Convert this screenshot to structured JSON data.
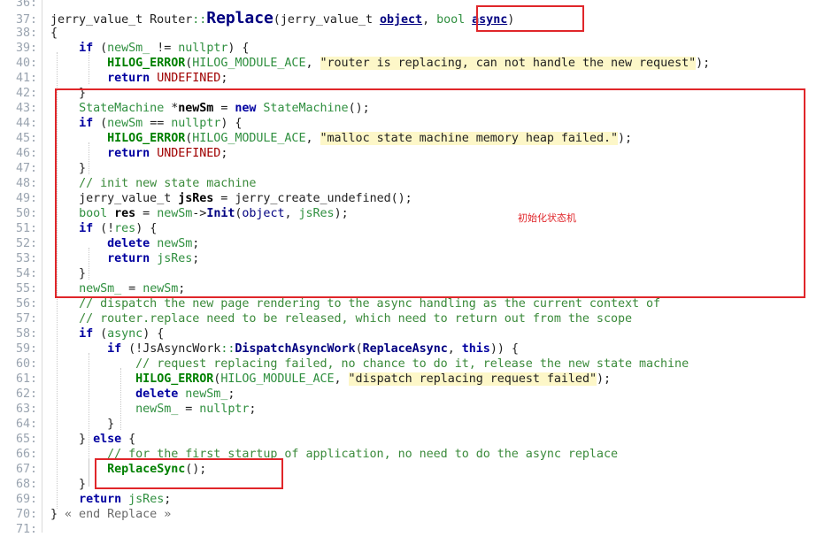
{
  "lines": [
    {
      "n": "36:",
      "tokens": []
    },
    {
      "n": "37:",
      "tokens": [
        {
          "c": "t-type",
          "t": "jerry_value_t "
        },
        {
          "c": "t-type",
          "t": "Router"
        },
        {
          "c": "t-ns",
          "t": "::"
        },
        {
          "c": "t-fnbig",
          "t": "Replace"
        },
        {
          "c": "t-op",
          "t": "("
        },
        {
          "c": "t-type",
          "t": "jerry_value_t "
        },
        {
          "c": "t-param",
          "t": "object"
        },
        {
          "c": "t-op",
          "t": ", "
        },
        {
          "c": "t-green",
          "t": "bool "
        },
        {
          "c": "t-param",
          "t": "async"
        },
        {
          "c": "t-op",
          "t": ")"
        }
      ]
    },
    {
      "n": "38:",
      "tokens": [
        {
          "c": "t-op",
          "t": "{"
        }
      ]
    },
    {
      "n": "39:",
      "tokens": [
        {
          "c": "t-op",
          "t": "    "
        },
        {
          "c": "t-kw",
          "t": "if"
        },
        {
          "c": "t-op",
          "t": " ("
        },
        {
          "c": "t-green",
          "t": "newSm_"
        },
        {
          "c": "t-op",
          "t": " != "
        },
        {
          "c": "t-nul",
          "t": "nullptr"
        },
        {
          "c": "t-op",
          "t": ") {"
        }
      ]
    },
    {
      "n": "40:",
      "tokens": [
        {
          "c": "t-op",
          "t": "        "
        },
        {
          "c": "t-mac",
          "t": "HILOG_ERROR"
        },
        {
          "c": "t-op",
          "t": "("
        },
        {
          "c": "t-macarg",
          "t": "HILOG_MODULE_ACE"
        },
        {
          "c": "t-op",
          "t": ", "
        },
        {
          "c": "t-str",
          "t": "\"router is replacing, can not handle the new request\""
        },
        {
          "c": "t-op",
          "t": ");"
        }
      ]
    },
    {
      "n": "41:",
      "tokens": [
        {
          "c": "t-op",
          "t": "        "
        },
        {
          "c": "t-kw",
          "t": "return"
        },
        {
          "c": "t-op",
          "t": " "
        },
        {
          "c": "t-const",
          "t": "UNDEFINED"
        },
        {
          "c": "t-op",
          "t": ";"
        }
      ]
    },
    {
      "n": "42:",
      "tokens": [
        {
          "c": "t-op",
          "t": "    }"
        }
      ]
    },
    {
      "n": "43:",
      "tokens": [
        {
          "c": "t-op",
          "t": "    "
        },
        {
          "c": "t-cls",
          "t": "StateMachine"
        },
        {
          "c": "t-op",
          "t": " *"
        },
        {
          "c": "t-varb",
          "t": "newSm"
        },
        {
          "c": "t-op",
          "t": " = "
        },
        {
          "c": "t-kw",
          "t": "new"
        },
        {
          "c": "t-op",
          "t": " "
        },
        {
          "c": "t-cls",
          "t": "StateMachine"
        },
        {
          "c": "t-op",
          "t": "();"
        }
      ]
    },
    {
      "n": "44:",
      "tokens": [
        {
          "c": "t-op",
          "t": "    "
        },
        {
          "c": "t-kw",
          "t": "if"
        },
        {
          "c": "t-op",
          "t": " ("
        },
        {
          "c": "t-green",
          "t": "newSm"
        },
        {
          "c": "t-op",
          "t": " == "
        },
        {
          "c": "t-nul",
          "t": "nullptr"
        },
        {
          "c": "t-op",
          "t": ") {"
        }
      ]
    },
    {
      "n": "45:",
      "tokens": [
        {
          "c": "t-op",
          "t": "        "
        },
        {
          "c": "t-mac",
          "t": "HILOG_ERROR"
        },
        {
          "c": "t-op",
          "t": "("
        },
        {
          "c": "t-macarg",
          "t": "HILOG_MODULE_ACE"
        },
        {
          "c": "t-op",
          "t": ", "
        },
        {
          "c": "t-str",
          "t": "\"malloc state machine memory heap failed.\""
        },
        {
          "c": "t-op",
          "t": ");"
        }
      ]
    },
    {
      "n": "46:",
      "tokens": [
        {
          "c": "t-op",
          "t": "        "
        },
        {
          "c": "t-kw",
          "t": "return"
        },
        {
          "c": "t-op",
          "t": " "
        },
        {
          "c": "t-const",
          "t": "UNDEFINED"
        },
        {
          "c": "t-op",
          "t": ";"
        }
      ]
    },
    {
      "n": "47:",
      "tokens": [
        {
          "c": "t-op",
          "t": "    }"
        }
      ]
    },
    {
      "n": "48:",
      "tokens": [
        {
          "c": "t-op",
          "t": "    "
        },
        {
          "c": "t-com",
          "t": "// init new state machine"
        }
      ]
    },
    {
      "n": "49:",
      "tokens": [
        {
          "c": "t-op",
          "t": "    "
        },
        {
          "c": "t-type",
          "t": "jerry_value_t "
        },
        {
          "c": "t-varb",
          "t": "jsRes"
        },
        {
          "c": "t-op",
          "t": " = "
        },
        {
          "c": "t-type",
          "t": "jerry_create_undefined"
        },
        {
          "c": "t-op",
          "t": "();"
        }
      ]
    },
    {
      "n": "50:",
      "tokens": [
        {
          "c": "t-op",
          "t": "    "
        },
        {
          "c": "t-green",
          "t": "bool "
        },
        {
          "c": "t-varb",
          "t": "res"
        },
        {
          "c": "t-op",
          "t": " = "
        },
        {
          "c": "t-green",
          "t": "newSm"
        },
        {
          "c": "t-op",
          "t": "->"
        },
        {
          "c": "t-fn",
          "t": "Init"
        },
        {
          "c": "t-op",
          "t": "("
        },
        {
          "c": "t-var",
          "t": "object"
        },
        {
          "c": "t-op",
          "t": ", "
        },
        {
          "c": "t-green",
          "t": "jsRes"
        },
        {
          "c": "t-op",
          "t": ");"
        }
      ]
    },
    {
      "n": "51:",
      "tokens": [
        {
          "c": "t-op",
          "t": "    "
        },
        {
          "c": "t-kw",
          "t": "if"
        },
        {
          "c": "t-op",
          "t": " (!"
        },
        {
          "c": "t-green",
          "t": "res"
        },
        {
          "c": "t-op",
          "t": ") {"
        }
      ]
    },
    {
      "n": "52:",
      "tokens": [
        {
          "c": "t-op",
          "t": "        "
        },
        {
          "c": "t-kw",
          "t": "delete"
        },
        {
          "c": "t-op",
          "t": " "
        },
        {
          "c": "t-green",
          "t": "newSm"
        },
        {
          "c": "t-op",
          "t": ";"
        }
      ]
    },
    {
      "n": "53:",
      "tokens": [
        {
          "c": "t-op",
          "t": "        "
        },
        {
          "c": "t-kw",
          "t": "return"
        },
        {
          "c": "t-op",
          "t": " "
        },
        {
          "c": "t-green",
          "t": "jsRes"
        },
        {
          "c": "t-op",
          "t": ";"
        }
      ]
    },
    {
      "n": "54:",
      "tokens": [
        {
          "c": "t-op",
          "t": "    }"
        }
      ]
    },
    {
      "n": "55:",
      "tokens": [
        {
          "c": "t-op",
          "t": "    "
        },
        {
          "c": "t-green",
          "t": "newSm_"
        },
        {
          "c": "t-op",
          "t": " = "
        },
        {
          "c": "t-green",
          "t": "newSm"
        },
        {
          "c": "t-op",
          "t": ";"
        }
      ]
    },
    {
      "n": "56:",
      "tokens": [
        {
          "c": "t-op",
          "t": "    "
        },
        {
          "c": "t-com",
          "t": "// dispatch the new page rendering to the async handling as the current context of"
        }
      ]
    },
    {
      "n": "57:",
      "tokens": [
        {
          "c": "t-op",
          "t": "    "
        },
        {
          "c": "t-com",
          "t": "// router.replace need to be released, which need to return out from the scope"
        }
      ]
    },
    {
      "n": "58:",
      "tokens": [
        {
          "c": "t-op",
          "t": "    "
        },
        {
          "c": "t-kw",
          "t": "if"
        },
        {
          "c": "t-op",
          "t": " ("
        },
        {
          "c": "t-green",
          "t": "async"
        },
        {
          "c": "t-op",
          "t": ") {"
        }
      ]
    },
    {
      "n": "59:",
      "tokens": [
        {
          "c": "t-op",
          "t": "        "
        },
        {
          "c": "t-kw",
          "t": "if"
        },
        {
          "c": "t-op",
          "t": " (!"
        },
        {
          "c": "t-type",
          "t": "JsAsyncWork"
        },
        {
          "c": "t-ns",
          "t": "::"
        },
        {
          "c": "t-fn",
          "t": "DispatchAsyncWork"
        },
        {
          "c": "t-op",
          "t": "("
        },
        {
          "c": "t-fn",
          "t": "ReplaceAsync"
        },
        {
          "c": "t-op",
          "t": ", "
        },
        {
          "c": "t-kw",
          "t": "this"
        },
        {
          "c": "t-op",
          "t": ")) {"
        }
      ]
    },
    {
      "n": "60:",
      "tokens": [
        {
          "c": "t-op",
          "t": "            "
        },
        {
          "c": "t-com",
          "t": "// request replacing failed, no chance to do it, release the new state machine"
        }
      ]
    },
    {
      "n": "61:",
      "tokens": [
        {
          "c": "t-op",
          "t": "            "
        },
        {
          "c": "t-mac",
          "t": "HILOG_ERROR"
        },
        {
          "c": "t-op",
          "t": "("
        },
        {
          "c": "t-macarg",
          "t": "HILOG_MODULE_ACE"
        },
        {
          "c": "t-op",
          "t": ", "
        },
        {
          "c": "t-str",
          "t": "\"dispatch replacing request failed\""
        },
        {
          "c": "t-op",
          "t": ");"
        }
      ]
    },
    {
      "n": "62:",
      "tokens": [
        {
          "c": "t-op",
          "t": "            "
        },
        {
          "c": "t-kw",
          "t": "delete"
        },
        {
          "c": "t-op",
          "t": " "
        },
        {
          "c": "t-green",
          "t": "newSm_"
        },
        {
          "c": "t-op",
          "t": ";"
        }
      ]
    },
    {
      "n": "63:",
      "tokens": [
        {
          "c": "t-op",
          "t": "            "
        },
        {
          "c": "t-green",
          "t": "newSm_"
        },
        {
          "c": "t-op",
          "t": " = "
        },
        {
          "c": "t-nul",
          "t": "nullptr"
        },
        {
          "c": "t-op",
          "t": ";"
        }
      ]
    },
    {
      "n": "64:",
      "tokens": [
        {
          "c": "t-op",
          "t": "        }"
        }
      ]
    },
    {
      "n": "65:",
      "tokens": [
        {
          "c": "t-op",
          "t": "    } "
        },
        {
          "c": "t-kw",
          "t": "else"
        },
        {
          "c": "t-op",
          "t": " {"
        }
      ]
    },
    {
      "n": "66:",
      "tokens": [
        {
          "c": "t-op",
          "t": "        "
        },
        {
          "c": "t-com",
          "t": "// for the first startup of application, no need to do the async replace"
        }
      ]
    },
    {
      "n": "67:",
      "tokens": [
        {
          "c": "t-op",
          "t": "        "
        },
        {
          "c": "t-mac",
          "t": "ReplaceSync"
        },
        {
          "c": "t-op",
          "t": "();"
        }
      ]
    },
    {
      "n": "68:",
      "tokens": [
        {
          "c": "t-op",
          "t": "    }"
        }
      ]
    },
    {
      "n": "69:",
      "tokens": [
        {
          "c": "t-op",
          "t": "    "
        },
        {
          "c": "t-kw",
          "t": "return"
        },
        {
          "c": "t-op",
          "t": " "
        },
        {
          "c": "t-green",
          "t": "jsRes"
        },
        {
          "c": "t-op",
          "t": ";"
        }
      ]
    },
    {
      "n": "70:",
      "tokens": [
        {
          "c": "t-op",
          "t": "} "
        },
        {
          "c": "t-endc",
          "t": "« end Replace »"
        }
      ]
    },
    {
      "n": "71:",
      "tokens": []
    }
  ],
  "annotation": {
    "label": "初始化状态机",
    "color": "#e0262a"
  }
}
